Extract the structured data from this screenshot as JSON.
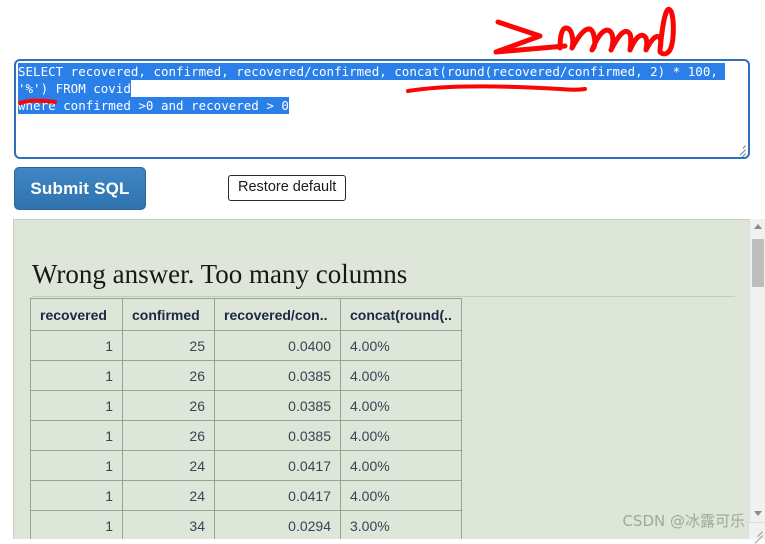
{
  "editor": {
    "name": "sql-query-editor",
    "selected": true,
    "line1": "SELECT recovered, confirmed, recovered/confirmed, concat(round(recovered/confirmed, 2) * 100, '%') FROM covid",
    "line2": "where confirmed >0 and recovered > 0",
    "border_color": "#2f6fc0",
    "selection_color": "#2a7fe8"
  },
  "toolbar": {
    "submit_label": "Submit SQL",
    "restore_label": "Restore default",
    "submit_color": "#3578b3"
  },
  "result": {
    "title": "Wrong answer. Too many columns",
    "panel_color": "#dde6d8",
    "table": {
      "headers": [
        "recovered",
        "confirmed",
        "recovered/con..",
        "concat(round(.."
      ],
      "rows": [
        [
          "1",
          "25",
          "0.0400",
          "4.00%"
        ],
        [
          "1",
          "26",
          "0.0385",
          "4.00%"
        ],
        [
          "1",
          "26",
          "0.0385",
          "4.00%"
        ],
        [
          "1",
          "26",
          "0.0385",
          "4.00%"
        ],
        [
          "1",
          "24",
          "0.0417",
          "4.00%"
        ],
        [
          "1",
          "24",
          "0.0417",
          "4.00%"
        ],
        [
          "1",
          "34",
          "0.0294",
          "3.00%"
        ]
      ]
    }
  },
  "scrollbar": {
    "up_icon": "triangle-up-icon",
    "down_icon": "triangle-down-icon",
    "thumb": "scroll-thumb"
  },
  "watermark": {
    "text": "CSDN @冰露可乐"
  },
  "annotations": {
    "color": "#fb0505",
    "scribble_note": "handwritten-red-scribble",
    "underline_1": "red-underline-under-round-expression",
    "underline_2": "red-underline-under-where"
  }
}
